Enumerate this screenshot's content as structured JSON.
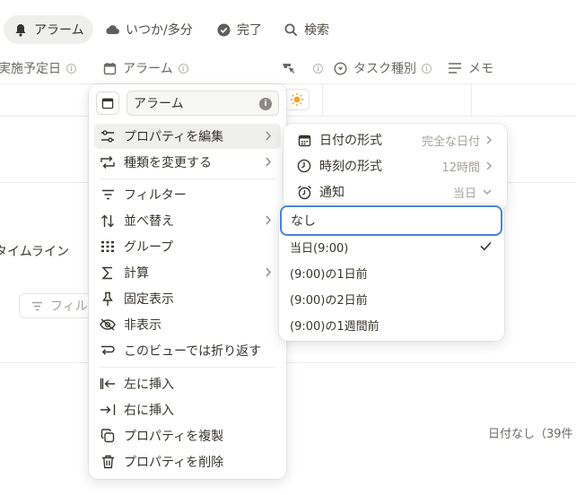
{
  "tabs": [
    {
      "label": "アラーム",
      "icon": "bell-icon",
      "active": true
    },
    {
      "label": "いつか/多分",
      "icon": "cloud-icon",
      "active": false
    },
    {
      "label": "完了",
      "icon": "check-circle-icon",
      "active": false
    },
    {
      "label": "検索",
      "icon": "search-icon",
      "active": false
    }
  ],
  "columns": {
    "scheduled": "実施予定日",
    "alarm": "アラーム",
    "task_type": "タスク種別",
    "memo": "メモ"
  },
  "background": {
    "timeline": "タイムライン",
    "filter": "フィルタ",
    "no_date": "日付なし（39件"
  },
  "cell_icon": "sun-emoji-icon",
  "prop_menu": {
    "name_value": "アラーム",
    "items": [
      {
        "label": "プロパティを編集",
        "icon": "sliders-icon",
        "submenu": true
      },
      {
        "label": "種類を変更する",
        "icon": "change-type-icon",
        "submenu": true
      },
      {
        "label": "フィルター",
        "icon": "filter-icon",
        "submenu": false
      },
      {
        "label": "並べ替え",
        "icon": "sort-icon",
        "submenu": true
      },
      {
        "label": "グループ",
        "icon": "group-icon",
        "submenu": false
      },
      {
        "label": "計算",
        "icon": "sigma-icon",
        "submenu": true
      },
      {
        "label": "固定表示",
        "icon": "pin-icon",
        "submenu": false
      },
      {
        "label": "非表示",
        "icon": "eye-off-icon",
        "submenu": false
      },
      {
        "label": "このビューでは折り返す",
        "icon": "wrap-icon",
        "submenu": false
      },
      {
        "label": "左に挿入",
        "icon": "insert-left-icon",
        "submenu": false
      },
      {
        "label": "右に挿入",
        "icon": "insert-right-icon",
        "submenu": false
      },
      {
        "label": "プロパティを複製",
        "icon": "duplicate-icon",
        "submenu": false
      },
      {
        "label": "プロパティを削除",
        "icon": "trash-icon",
        "submenu": false
      }
    ]
  },
  "date_menu": {
    "rows": [
      {
        "label": "日付の形式",
        "value": "完全な日付",
        "icon": "calendar-icon"
      },
      {
        "label": "時刻の形式",
        "value": "12時間",
        "icon": "clock-icon"
      },
      {
        "label": "通知",
        "value": "当日",
        "icon": "alarm-clock-icon"
      }
    ]
  },
  "notify_options": {
    "items": [
      "なし",
      "当日(9:00)",
      "(9:00)の1日前",
      "(9:00)の2日前",
      "(9:00)の1週間前"
    ],
    "checked": "当日(9:00)"
  }
}
